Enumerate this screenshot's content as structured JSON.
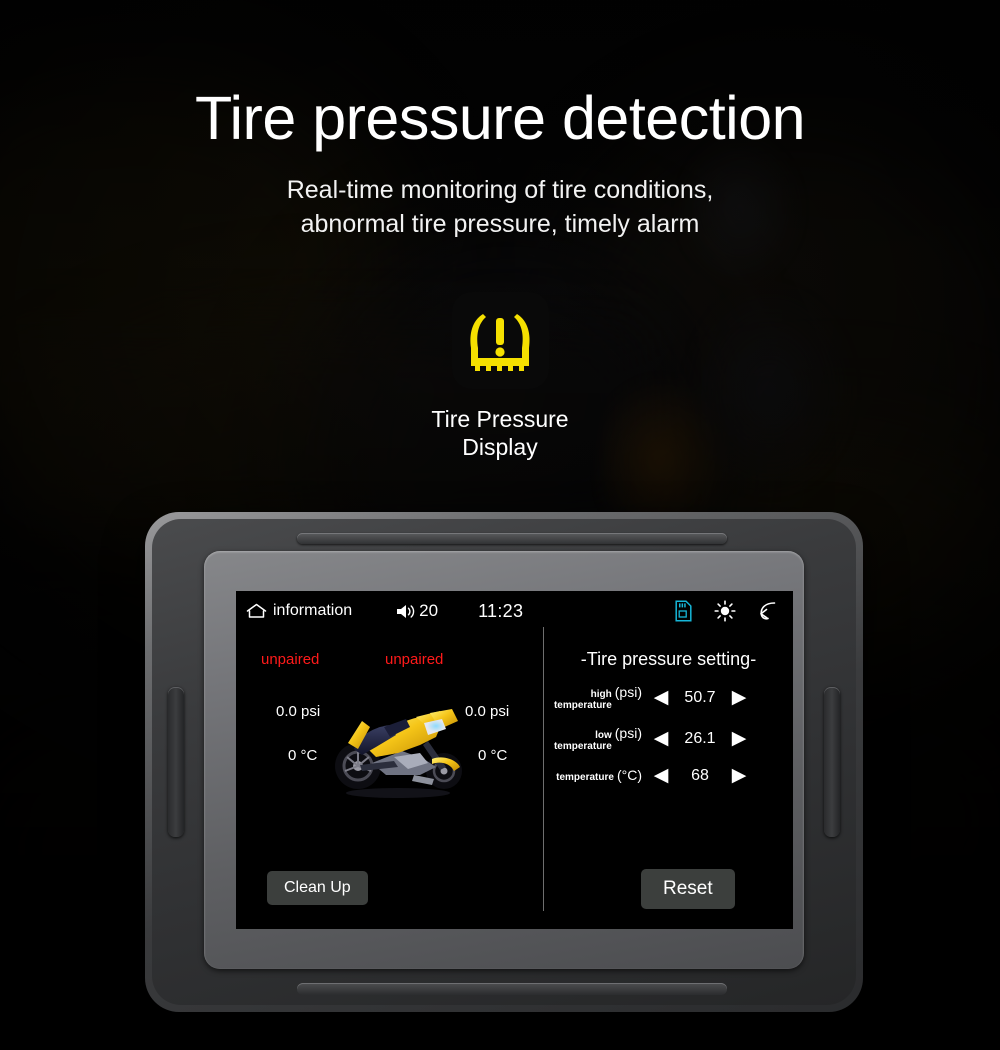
{
  "hero": {
    "title": "Tire pressure detection",
    "subtitle_line1": "Real-time monitoring of tire conditions,",
    "subtitle_line2": "abnormal tire pressure, timely alarm"
  },
  "tpms_badge": {
    "icon": "tire-pressure-warning-icon",
    "icon_color": "#f5e000",
    "badge_color": "#090909",
    "caption_line1": "Tire Pressure",
    "caption_line2": "Display"
  },
  "device": {
    "screen": {
      "statusbar": {
        "home_icon": "home-icon",
        "home_label": "information",
        "volume_icon": "speaker-icon",
        "volume_value": "20",
        "clock": "11:23",
        "sd_icon": "sd-card-icon",
        "sd_icon_color": "#16b6d8",
        "brightness_icon": "brightness-sun-icon",
        "back_icon": "back-arrow-icon"
      },
      "left_panel": {
        "front_status": "unpaired",
        "rear_status": "unpaired",
        "front_pressure": "0.0 psi",
        "rear_pressure": "0.0 psi",
        "front_temperature": "0  °C",
        "rear_temperature": "0  °C",
        "vehicle_image": "motorcycle-illustration",
        "clean_up_label": "Clean Up",
        "status_color": "#ff1a1a"
      },
      "right_panel": {
        "title": "-Tire pressure setting-",
        "rows": [
          {
            "label_words": "high\ntemperature",
            "label_line1": "high",
            "label_line2": "temperature",
            "unit": "(psi)",
            "decrease_icon": "chevron-left-icon",
            "increase_icon": "chevron-right-icon",
            "value": "50.7"
          },
          {
            "label_line1": "low",
            "label_line2": "temperature",
            "unit": "(psi)",
            "decrease_icon": "chevron-left-icon",
            "increase_icon": "chevron-right-icon",
            "value": "26.1"
          },
          {
            "label_line1": "",
            "label_line2": "temperature",
            "unit": "(°C)",
            "decrease_icon": "chevron-left-icon",
            "increase_icon": "chevron-right-icon",
            "value": "68"
          }
        ],
        "reset_label": "Reset"
      }
    }
  }
}
